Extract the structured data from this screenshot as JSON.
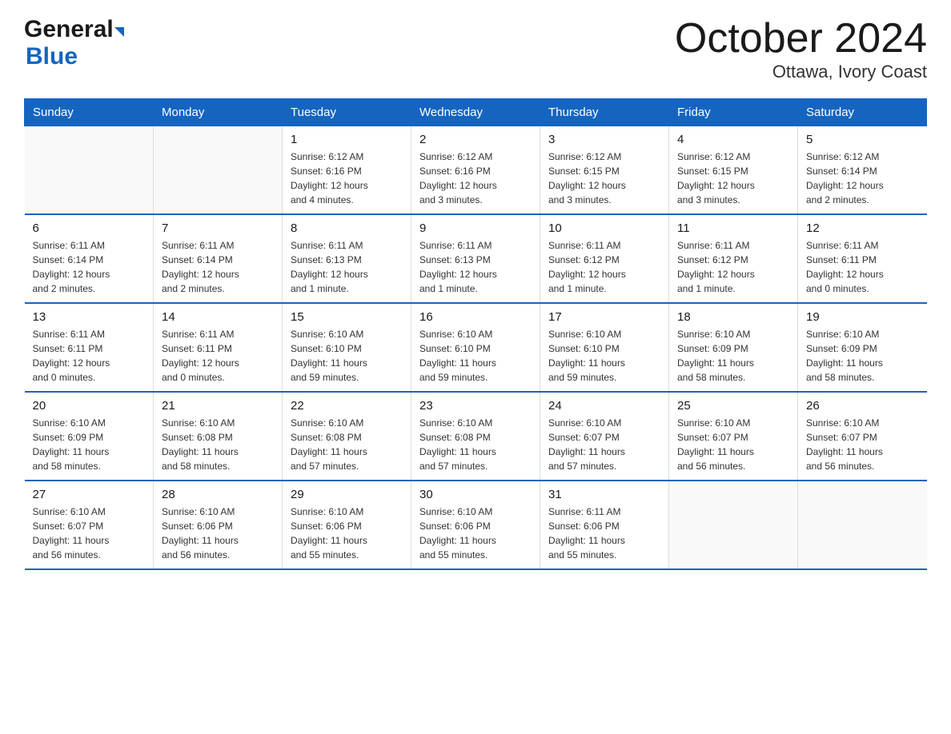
{
  "logo": {
    "general": "General",
    "blue": "Blue"
  },
  "title": "October 2024",
  "location": "Ottawa, Ivory Coast",
  "days_header": [
    "Sunday",
    "Monday",
    "Tuesday",
    "Wednesday",
    "Thursday",
    "Friday",
    "Saturday"
  ],
  "weeks": [
    [
      {
        "day": "",
        "info": ""
      },
      {
        "day": "",
        "info": ""
      },
      {
        "day": "1",
        "info": "Sunrise: 6:12 AM\nSunset: 6:16 PM\nDaylight: 12 hours\nand 4 minutes."
      },
      {
        "day": "2",
        "info": "Sunrise: 6:12 AM\nSunset: 6:16 PM\nDaylight: 12 hours\nand 3 minutes."
      },
      {
        "day": "3",
        "info": "Sunrise: 6:12 AM\nSunset: 6:15 PM\nDaylight: 12 hours\nand 3 minutes."
      },
      {
        "day": "4",
        "info": "Sunrise: 6:12 AM\nSunset: 6:15 PM\nDaylight: 12 hours\nand 3 minutes."
      },
      {
        "day": "5",
        "info": "Sunrise: 6:12 AM\nSunset: 6:14 PM\nDaylight: 12 hours\nand 2 minutes."
      }
    ],
    [
      {
        "day": "6",
        "info": "Sunrise: 6:11 AM\nSunset: 6:14 PM\nDaylight: 12 hours\nand 2 minutes."
      },
      {
        "day": "7",
        "info": "Sunrise: 6:11 AM\nSunset: 6:14 PM\nDaylight: 12 hours\nand 2 minutes."
      },
      {
        "day": "8",
        "info": "Sunrise: 6:11 AM\nSunset: 6:13 PM\nDaylight: 12 hours\nand 1 minute."
      },
      {
        "day": "9",
        "info": "Sunrise: 6:11 AM\nSunset: 6:13 PM\nDaylight: 12 hours\nand 1 minute."
      },
      {
        "day": "10",
        "info": "Sunrise: 6:11 AM\nSunset: 6:12 PM\nDaylight: 12 hours\nand 1 minute."
      },
      {
        "day": "11",
        "info": "Sunrise: 6:11 AM\nSunset: 6:12 PM\nDaylight: 12 hours\nand 1 minute."
      },
      {
        "day": "12",
        "info": "Sunrise: 6:11 AM\nSunset: 6:11 PM\nDaylight: 12 hours\nand 0 minutes."
      }
    ],
    [
      {
        "day": "13",
        "info": "Sunrise: 6:11 AM\nSunset: 6:11 PM\nDaylight: 12 hours\nand 0 minutes."
      },
      {
        "day": "14",
        "info": "Sunrise: 6:11 AM\nSunset: 6:11 PM\nDaylight: 12 hours\nand 0 minutes."
      },
      {
        "day": "15",
        "info": "Sunrise: 6:10 AM\nSunset: 6:10 PM\nDaylight: 11 hours\nand 59 minutes."
      },
      {
        "day": "16",
        "info": "Sunrise: 6:10 AM\nSunset: 6:10 PM\nDaylight: 11 hours\nand 59 minutes."
      },
      {
        "day": "17",
        "info": "Sunrise: 6:10 AM\nSunset: 6:10 PM\nDaylight: 11 hours\nand 59 minutes."
      },
      {
        "day": "18",
        "info": "Sunrise: 6:10 AM\nSunset: 6:09 PM\nDaylight: 11 hours\nand 58 minutes."
      },
      {
        "day": "19",
        "info": "Sunrise: 6:10 AM\nSunset: 6:09 PM\nDaylight: 11 hours\nand 58 minutes."
      }
    ],
    [
      {
        "day": "20",
        "info": "Sunrise: 6:10 AM\nSunset: 6:09 PM\nDaylight: 11 hours\nand 58 minutes."
      },
      {
        "day": "21",
        "info": "Sunrise: 6:10 AM\nSunset: 6:08 PM\nDaylight: 11 hours\nand 58 minutes."
      },
      {
        "day": "22",
        "info": "Sunrise: 6:10 AM\nSunset: 6:08 PM\nDaylight: 11 hours\nand 57 minutes."
      },
      {
        "day": "23",
        "info": "Sunrise: 6:10 AM\nSunset: 6:08 PM\nDaylight: 11 hours\nand 57 minutes."
      },
      {
        "day": "24",
        "info": "Sunrise: 6:10 AM\nSunset: 6:07 PM\nDaylight: 11 hours\nand 57 minutes."
      },
      {
        "day": "25",
        "info": "Sunrise: 6:10 AM\nSunset: 6:07 PM\nDaylight: 11 hours\nand 56 minutes."
      },
      {
        "day": "26",
        "info": "Sunrise: 6:10 AM\nSunset: 6:07 PM\nDaylight: 11 hours\nand 56 minutes."
      }
    ],
    [
      {
        "day": "27",
        "info": "Sunrise: 6:10 AM\nSunset: 6:07 PM\nDaylight: 11 hours\nand 56 minutes."
      },
      {
        "day": "28",
        "info": "Sunrise: 6:10 AM\nSunset: 6:06 PM\nDaylight: 11 hours\nand 56 minutes."
      },
      {
        "day": "29",
        "info": "Sunrise: 6:10 AM\nSunset: 6:06 PM\nDaylight: 11 hours\nand 55 minutes."
      },
      {
        "day": "30",
        "info": "Sunrise: 6:10 AM\nSunset: 6:06 PM\nDaylight: 11 hours\nand 55 minutes."
      },
      {
        "day": "31",
        "info": "Sunrise: 6:11 AM\nSunset: 6:06 PM\nDaylight: 11 hours\nand 55 minutes."
      },
      {
        "day": "",
        "info": ""
      },
      {
        "day": "",
        "info": ""
      }
    ]
  ]
}
